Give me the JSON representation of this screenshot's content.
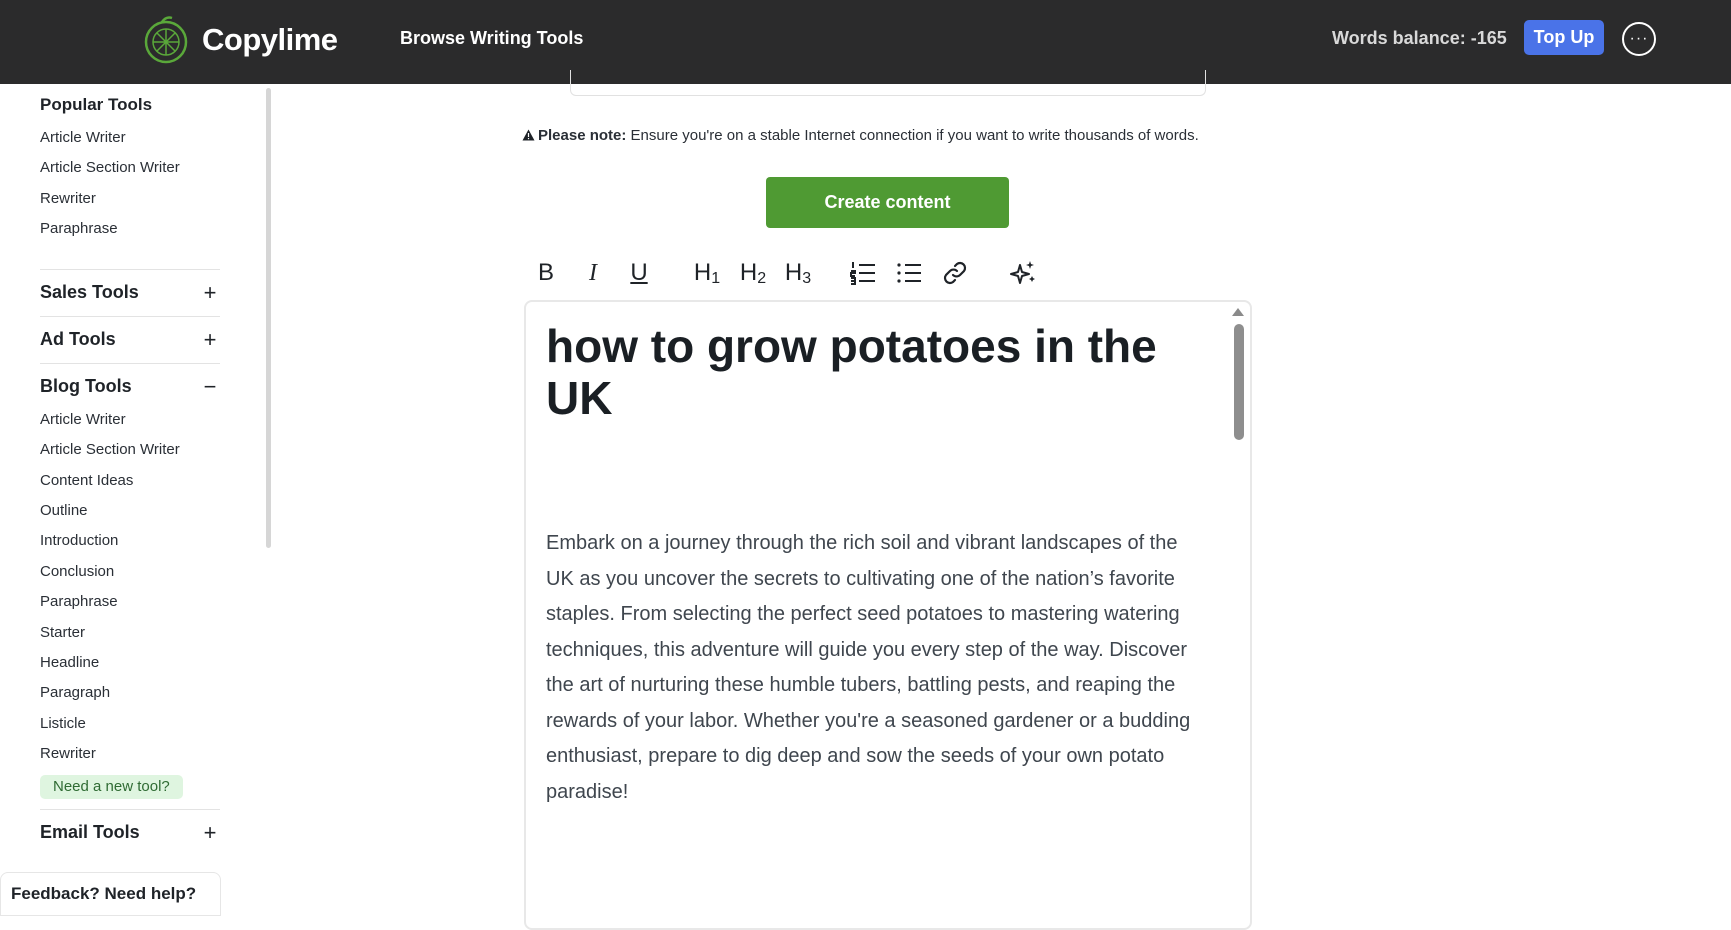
{
  "header": {
    "brand": "Copylime",
    "browse_label": "Browse Writing Tools",
    "words_balance": "Words balance: -165",
    "topup_label": "Top Up",
    "more_glyph": "···"
  },
  "sidebar": {
    "popular_title": "Popular Tools",
    "popular_items": [
      "Article Writer",
      "Article Section Writer",
      "Rewriter",
      "Paraphrase"
    ],
    "sections": [
      {
        "label": "Sales Tools",
        "symbol": "+"
      },
      {
        "label": "Ad Tools",
        "symbol": "+"
      },
      {
        "label": "Blog Tools",
        "symbol": "−"
      },
      {
        "label": "Email Tools",
        "symbol": "+"
      }
    ],
    "blog_items": [
      "Article Writer",
      "Article Section Writer",
      "Content Ideas",
      "Outline",
      "Introduction",
      "Conclusion",
      "Paraphrase",
      "Starter",
      "Headline",
      "Paragraph",
      "Listicle",
      "Rewriter"
    ],
    "new_tool_label": "Need a new tool?",
    "feedback_label": "Feedback? Need help?"
  },
  "main": {
    "note_bold": "Please note:",
    "note_text": " Ensure you're on a stable Internet connection if you want to write thousands of words.",
    "create_label": "Create content",
    "toolbar": {
      "bold": "B",
      "italic": "I",
      "underline": "U",
      "h1": "H",
      "h1_sub": "1",
      "h2": "H",
      "h2_sub": "2",
      "h3": "H",
      "h3_sub": "3"
    },
    "editor": {
      "title": "how to grow potatoes in the UK",
      "body": "Embark on a journey through the rich soil and vibrant landscapes of the UK as you uncover the secrets to cultivating one of the nation’s favorite staples. From selecting the perfect seed potatoes to mastering watering techniques, this adventure will guide you every step of the way. Discover the art of nurturing these humble tubers, battling pests, and reaping the rewards of your labor. Whether you're a seasoned gardener or a budding enthusiast, prepare to dig deep and sow the seeds of your own potato paradise!"
    }
  },
  "colors": {
    "topbar": "#2b2b2c",
    "topup": "#4a73e8",
    "create": "#4f9a33",
    "new_tool_bg": "#dff5e0"
  }
}
